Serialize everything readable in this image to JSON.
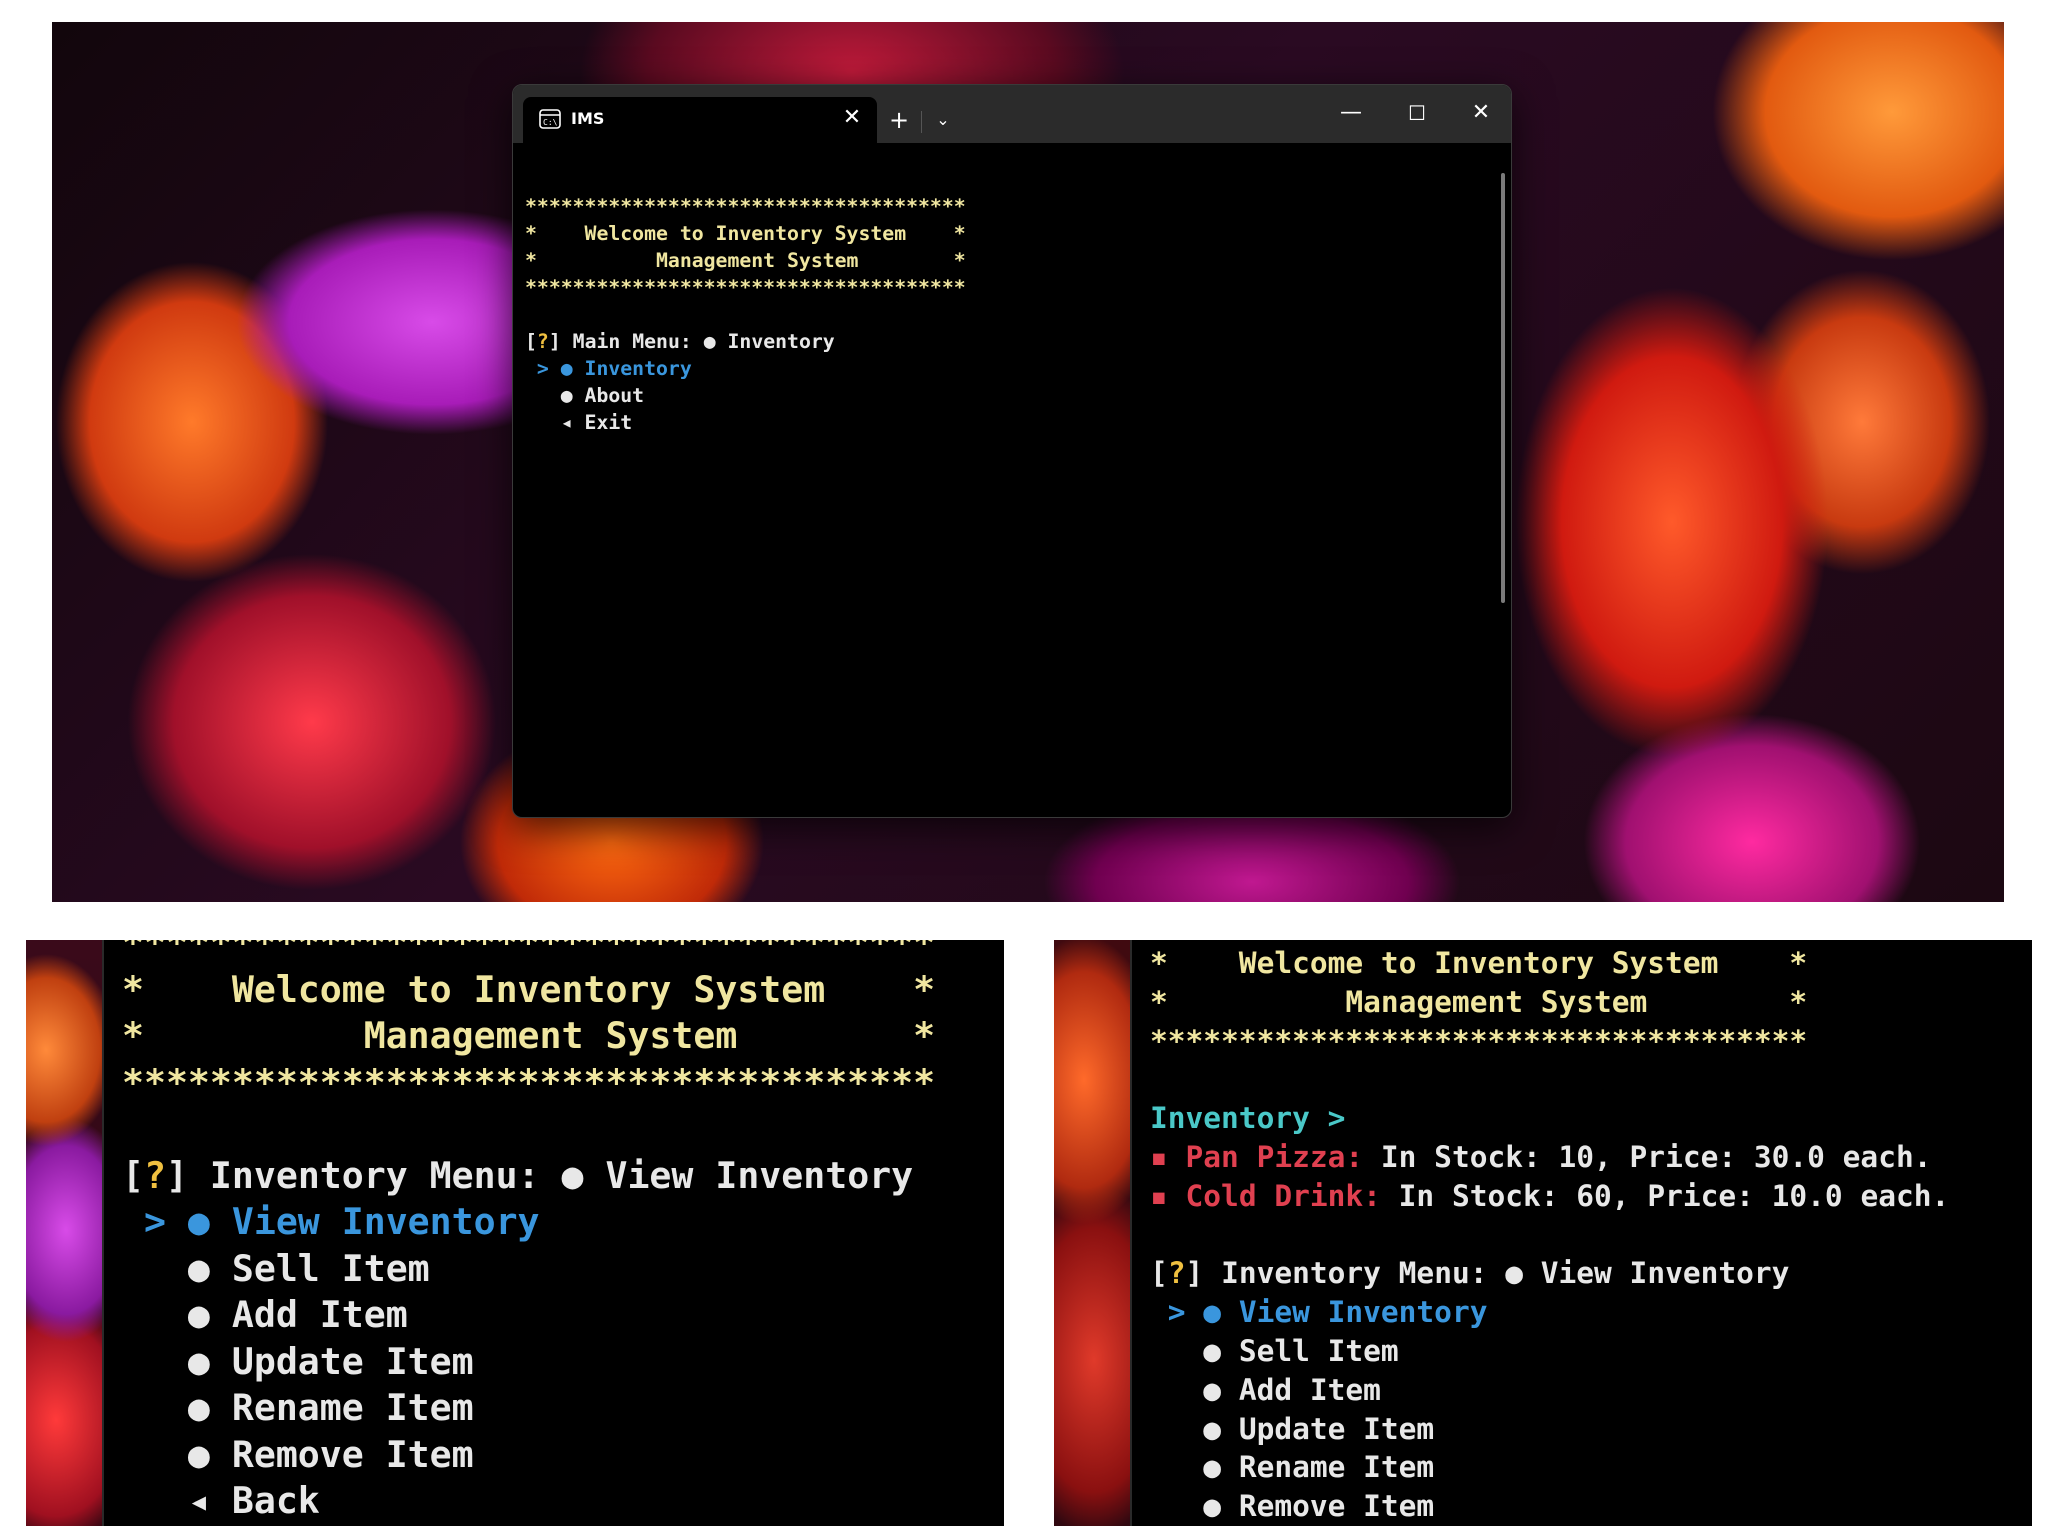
{
  "window": {
    "tab_title": "IMS",
    "icons": [
      "terminal-icon",
      "close-icon",
      "plus-icon",
      "chevron-down-icon",
      "minimize-icon",
      "maximize-icon",
      "close-icon"
    ],
    "scrollbar": "scrollbar"
  },
  "banner": {
    "border": "*************************************",
    "line1": "*    Welcome to Inventory System    *",
    "line2": "*          Management System        *"
  },
  "main_menu": {
    "prompt_open": "[",
    "prompt_q": "?",
    "prompt_close": "] ",
    "question": "Main Menu: ",
    "answer": "● Inventory",
    "options": [
      {
        "marker": " > ● ",
        "label": "Inventory",
        "selected": true
      },
      {
        "marker": "   ● ",
        "label": "About",
        "selected": false
      },
      {
        "marker": "   ◂ ",
        "label": "Exit",
        "selected": false
      }
    ]
  },
  "inventory_menu": {
    "question": "Inventory Menu: ",
    "answer": "● View Inventory",
    "selected_marker": " > ● ",
    "selected_label": "View Inventory",
    "options": [
      {
        "marker": "   ● ",
        "label": "Sell Item"
      },
      {
        "marker": "   ● ",
        "label": "Add Item"
      },
      {
        "marker": "   ● ",
        "label": "Update Item"
      },
      {
        "marker": "   ● ",
        "label": "Rename Item"
      },
      {
        "marker": "   ● ",
        "label": "Remove Item"
      },
      {
        "marker": "   ◂ ",
        "label": "Back"
      }
    ]
  },
  "inventory_view": {
    "header": "Inventory >",
    "items": [
      {
        "bullet": "▪ ",
        "name": "Pan Pizza:",
        "details": " In Stock: 10, Price: 30.0 each."
      },
      {
        "bullet": "▪ ",
        "name": "Cold Drink:",
        "details": " In Stock: 60, Price: 10.0 each."
      }
    ]
  },
  "colors": {
    "banner": "#f0e6a0",
    "text": "#e8e8e8",
    "question_mark": "#f0c040",
    "selected": "#3a96dd",
    "inventory_header": "#4ac8c8",
    "item_name": "#e04050",
    "titlebar": "#2b2b2b",
    "terminal_bg": "#000000"
  }
}
